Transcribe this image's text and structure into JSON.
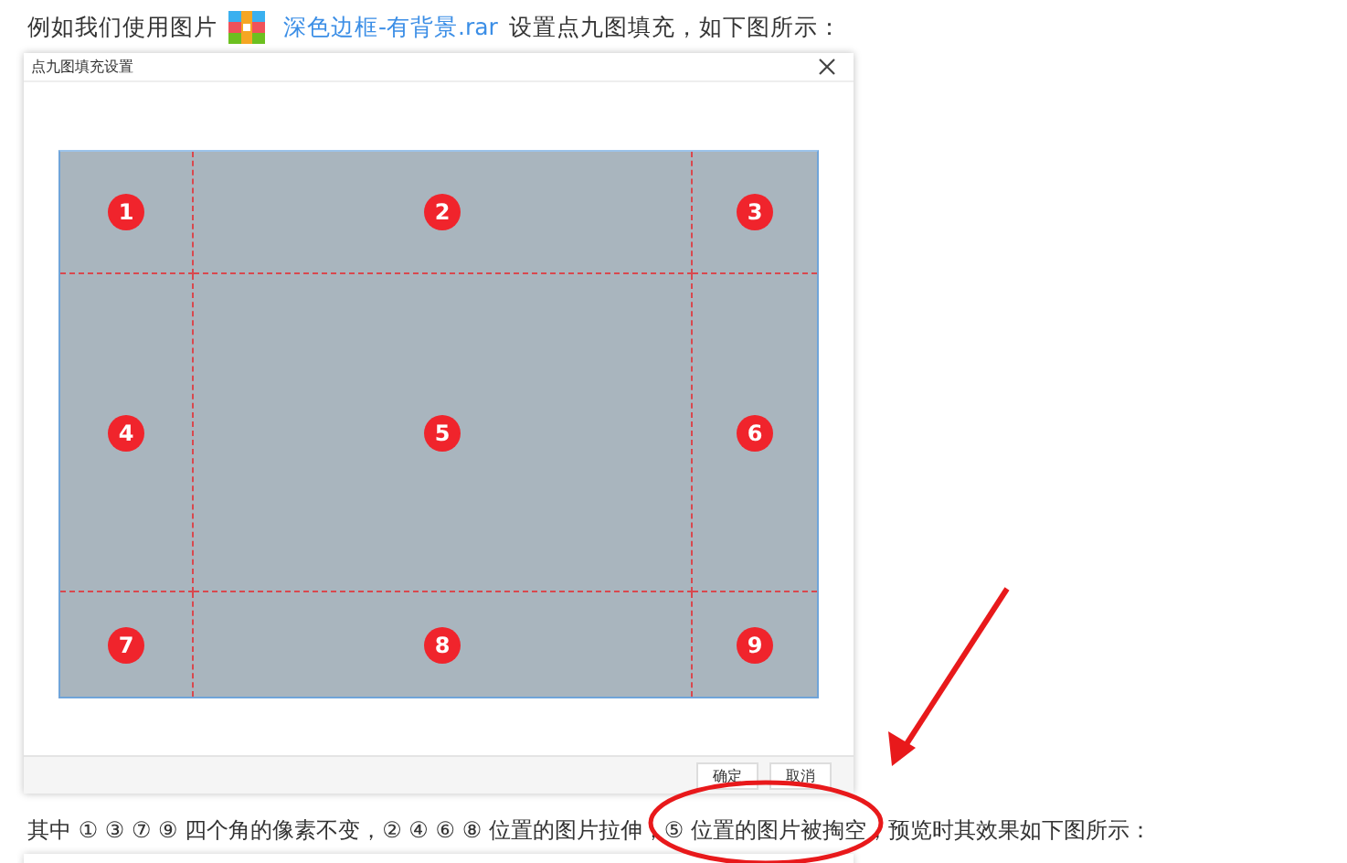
{
  "intro": {
    "before": "例如我们使用图片",
    "link": "深色边框-有背景.rar",
    "after": "设置点九图填充，如下图所示："
  },
  "dialog": {
    "title": "点九图填充设置",
    "cells": [
      "1",
      "2",
      "3",
      "4",
      "5",
      "6",
      "7",
      "8",
      "9"
    ],
    "buttons": [
      "确定",
      "取消"
    ]
  },
  "caption": "其中 ① ③ ⑦ ⑨ 四个角的像素不变，② ④ ⑥ ⑧ 位置的图片拉伸，⑤ 位置的图片被掏空，预览时其效果如下图所示："
}
